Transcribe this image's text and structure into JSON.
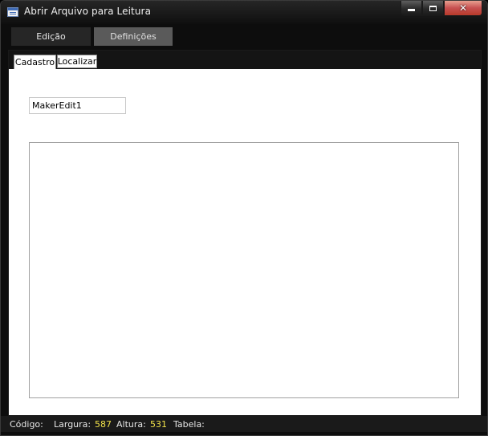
{
  "window": {
    "title": "Abrir Arquivo para Leitura",
    "caption_close": "✕"
  },
  "main_tabs": [
    {
      "label": "Edição",
      "active": true
    },
    {
      "label": "Definições",
      "active": false
    }
  ],
  "sub_tabs": [
    {
      "label": "Cadastro",
      "active": true
    },
    {
      "label": "Localizar",
      "active": false
    }
  ],
  "form": {
    "edit_value": "MakerEdit1",
    "memo_value": ""
  },
  "status_bar": {
    "codigo_label": "Código:",
    "largura_label": "Largura:",
    "largura_value": "587",
    "altura_label": "Altura:",
    "altura_value": "531",
    "tabela_label": "Tabela:"
  },
  "colors": {
    "status_value": "#f0e14a",
    "close_button": "#c75050",
    "active_tab": "#262626",
    "inactive_tab": "#5a5a5a"
  },
  "icons": {
    "app": "window-form-icon",
    "minimize": "minimize-icon",
    "maximize": "maximize-icon",
    "close": "close-icon"
  }
}
